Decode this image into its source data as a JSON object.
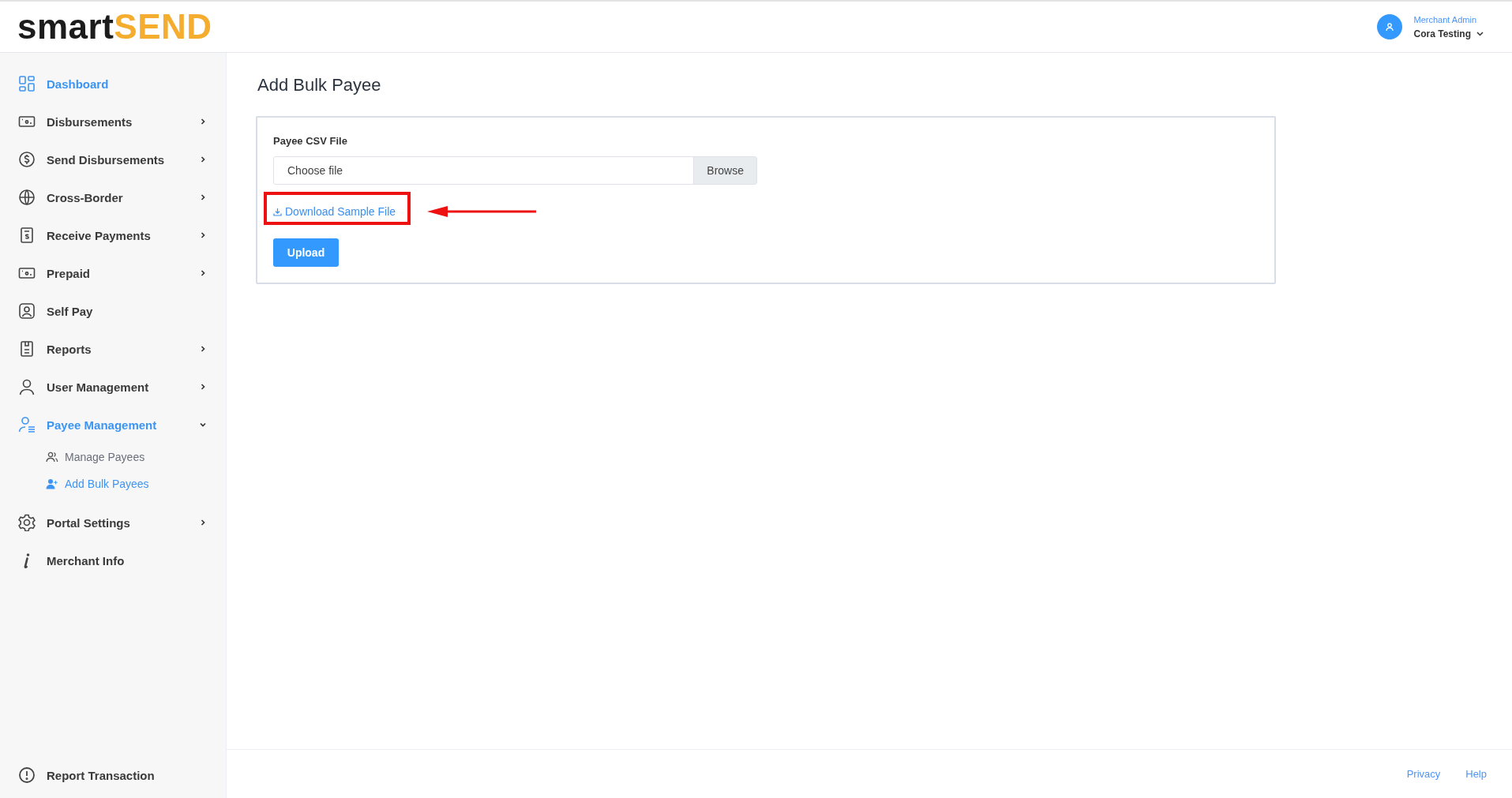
{
  "header": {
    "logo": {
      "part_1": "smart",
      "part_2": "SEND"
    },
    "user": {
      "role": "Merchant Admin",
      "name": "Cora Testing"
    }
  },
  "sidebar": {
    "items": [
      {
        "label": "Dashboard",
        "selected": true
      },
      {
        "label": "Disbursements",
        "selected": false,
        "expanded": false
      },
      {
        "label": "Send Disbursements",
        "selected": false,
        "expanded": false
      },
      {
        "label": "Cross-Border",
        "selected": false,
        "expanded": false
      },
      {
        "label": "Receive Payments",
        "selected": false,
        "expanded": false
      },
      {
        "label": "Prepaid",
        "selected": false,
        "expanded": false
      },
      {
        "label": "Self Pay",
        "selected": false
      },
      {
        "label": "Reports",
        "selected": false,
        "expanded": false
      },
      {
        "label": "User Management",
        "selected": false,
        "expanded": false
      },
      {
        "label": "Payee Management",
        "selected": true,
        "expanded": true,
        "children": [
          {
            "label": "Manage Payees",
            "selected": false
          },
          {
            "label": "Add Bulk Payees",
            "selected": true
          }
        ]
      },
      {
        "label": "Portal Settings",
        "selected": false,
        "expanded": false
      },
      {
        "label": "Merchant Info",
        "selected": false
      }
    ],
    "bottom_item": {
      "label": "Report Transaction"
    }
  },
  "page": {
    "title": "Add Bulk Payee",
    "form": {
      "label": "Payee CSV File",
      "file_input": {
        "placeholder": "Choose file",
        "button": "Browse"
      },
      "download_link": "Download Sample File",
      "submit": "Upload"
    }
  },
  "footer": {
    "links": [
      "Privacy",
      "Help"
    ]
  }
}
